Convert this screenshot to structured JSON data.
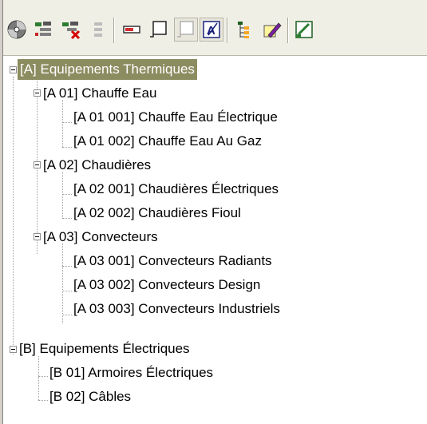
{
  "toolbar": {
    "buttons": [
      {
        "icon": "disc-icon"
      },
      {
        "icon": "add-item-icon"
      },
      {
        "icon": "delete-item-icon"
      },
      {
        "icon": "disabled-item-icon"
      },
      {
        "icon": "rectangle-icon"
      },
      {
        "icon": "node-icon"
      },
      {
        "icon": "node-disabled-icon"
      },
      {
        "icon": "edit-text-icon"
      },
      {
        "icon": "tree-view-icon"
      },
      {
        "icon": "edit-pencil-icon"
      },
      {
        "icon": "export-icon"
      }
    ]
  },
  "tree": {
    "nodes": [
      {
        "label": "[A] Equipements Thermiques",
        "selected": true
      },
      {
        "label": "[A 01] Chauffe Eau"
      },
      {
        "label": "[A 01 001] Chauffe Eau Électrique"
      },
      {
        "label": "[A 01 002] Chauffe Eau Au Gaz"
      },
      {
        "label": "[A 02] Chaudières"
      },
      {
        "label": "[A 02 001] Chaudières Électriques"
      },
      {
        "label": "[A 02 002] Chaudières Fioul"
      },
      {
        "label": "[A 03] Convecteurs"
      },
      {
        "label": "[A 03 001] Convecteurs Radiants"
      },
      {
        "label": "[A 03 002] Convecteurs Design"
      },
      {
        "label": "[A 03 003] Convecteurs Industriels"
      },
      {
        "label": "[B] Equipements Électriques"
      },
      {
        "label": "[B 01] Armoires Électriques"
      },
      {
        "label": "[B 02] Câbles"
      }
    ]
  },
  "colors": {
    "selection": "#8c8c61",
    "toolbar_bg": "#f0efe6"
  }
}
